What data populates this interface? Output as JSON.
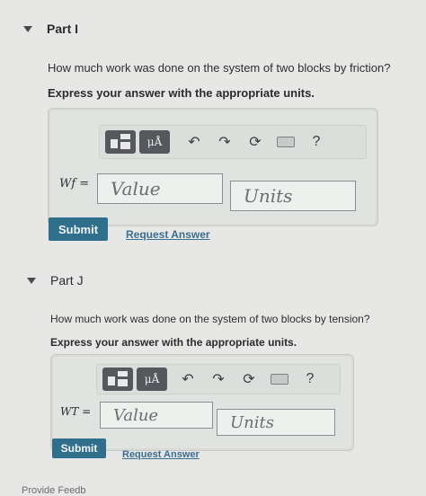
{
  "parts": [
    {
      "title": "Part I",
      "question": "How much work was done on the system of two blocks by friction?",
      "instruction": "Express your answer with the appropriate units.",
      "variable_label": "Wf =",
      "value_placeholder": "Value",
      "units_placeholder": "Units",
      "submit_label": "Submit",
      "request_label": "Request Answer"
    },
    {
      "title": "Part J",
      "question": "How much work was done on the system of two blocks by tension?",
      "instruction": "Express your answer with the appropriate units.",
      "variable_label": "WT =",
      "value_placeholder": "Value",
      "units_placeholder": "Units",
      "submit_label": "Submit",
      "request_label": "Request Answer"
    }
  ],
  "toolbar": {
    "template_icon": "templates-icon",
    "symbol_label": "μÅ",
    "undo_icon": "undo-icon",
    "redo_icon": "redo-icon",
    "reset_icon": "reset-icon",
    "keyboard_icon": "keyboard-icon",
    "help_label": "?"
  },
  "footer": {
    "provide_feedback": "Provide Feedb"
  },
  "colors": {
    "submit": "#2f6f8c",
    "link": "#3a6e93",
    "background": "#e7e8e5"
  }
}
